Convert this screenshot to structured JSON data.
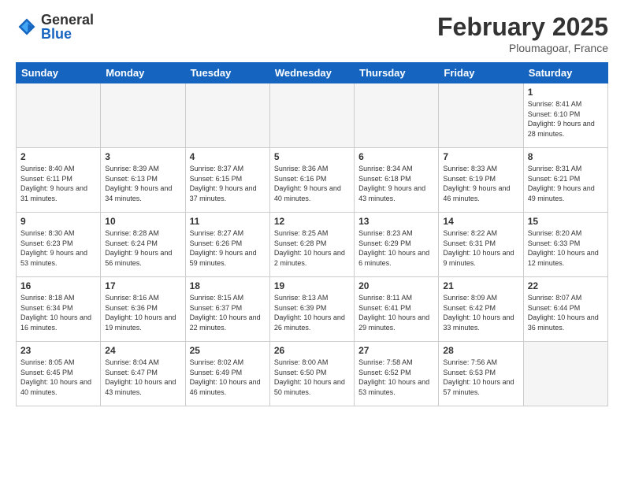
{
  "header": {
    "logo_general": "General",
    "logo_blue": "Blue",
    "month_title": "February 2025",
    "subtitle": "Ploumagoar, France"
  },
  "days_of_week": [
    "Sunday",
    "Monday",
    "Tuesday",
    "Wednesday",
    "Thursday",
    "Friday",
    "Saturday"
  ],
  "weeks": [
    [
      {
        "day": "",
        "empty": true
      },
      {
        "day": "",
        "empty": true
      },
      {
        "day": "",
        "empty": true
      },
      {
        "day": "",
        "empty": true
      },
      {
        "day": "",
        "empty": true
      },
      {
        "day": "",
        "empty": true
      },
      {
        "day": "1",
        "info": "Sunrise: 8:41 AM\nSunset: 6:10 PM\nDaylight: 9 hours and 28 minutes."
      }
    ],
    [
      {
        "day": "2",
        "info": "Sunrise: 8:40 AM\nSunset: 6:11 PM\nDaylight: 9 hours and 31 minutes."
      },
      {
        "day": "3",
        "info": "Sunrise: 8:39 AM\nSunset: 6:13 PM\nDaylight: 9 hours and 34 minutes."
      },
      {
        "day": "4",
        "info": "Sunrise: 8:37 AM\nSunset: 6:15 PM\nDaylight: 9 hours and 37 minutes."
      },
      {
        "day": "5",
        "info": "Sunrise: 8:36 AM\nSunset: 6:16 PM\nDaylight: 9 hours and 40 minutes."
      },
      {
        "day": "6",
        "info": "Sunrise: 8:34 AM\nSunset: 6:18 PM\nDaylight: 9 hours and 43 minutes."
      },
      {
        "day": "7",
        "info": "Sunrise: 8:33 AM\nSunset: 6:19 PM\nDaylight: 9 hours and 46 minutes."
      },
      {
        "day": "8",
        "info": "Sunrise: 8:31 AM\nSunset: 6:21 PM\nDaylight: 9 hours and 49 minutes."
      }
    ],
    [
      {
        "day": "9",
        "info": "Sunrise: 8:30 AM\nSunset: 6:23 PM\nDaylight: 9 hours and 53 minutes."
      },
      {
        "day": "10",
        "info": "Sunrise: 8:28 AM\nSunset: 6:24 PM\nDaylight: 9 hours and 56 minutes."
      },
      {
        "day": "11",
        "info": "Sunrise: 8:27 AM\nSunset: 6:26 PM\nDaylight: 9 hours and 59 minutes."
      },
      {
        "day": "12",
        "info": "Sunrise: 8:25 AM\nSunset: 6:28 PM\nDaylight: 10 hours and 2 minutes."
      },
      {
        "day": "13",
        "info": "Sunrise: 8:23 AM\nSunset: 6:29 PM\nDaylight: 10 hours and 6 minutes."
      },
      {
        "day": "14",
        "info": "Sunrise: 8:22 AM\nSunset: 6:31 PM\nDaylight: 10 hours and 9 minutes."
      },
      {
        "day": "15",
        "info": "Sunrise: 8:20 AM\nSunset: 6:33 PM\nDaylight: 10 hours and 12 minutes."
      }
    ],
    [
      {
        "day": "16",
        "info": "Sunrise: 8:18 AM\nSunset: 6:34 PM\nDaylight: 10 hours and 16 minutes."
      },
      {
        "day": "17",
        "info": "Sunrise: 8:16 AM\nSunset: 6:36 PM\nDaylight: 10 hours and 19 minutes."
      },
      {
        "day": "18",
        "info": "Sunrise: 8:15 AM\nSunset: 6:37 PM\nDaylight: 10 hours and 22 minutes."
      },
      {
        "day": "19",
        "info": "Sunrise: 8:13 AM\nSunset: 6:39 PM\nDaylight: 10 hours and 26 minutes."
      },
      {
        "day": "20",
        "info": "Sunrise: 8:11 AM\nSunset: 6:41 PM\nDaylight: 10 hours and 29 minutes."
      },
      {
        "day": "21",
        "info": "Sunrise: 8:09 AM\nSunset: 6:42 PM\nDaylight: 10 hours and 33 minutes."
      },
      {
        "day": "22",
        "info": "Sunrise: 8:07 AM\nSunset: 6:44 PM\nDaylight: 10 hours and 36 minutes."
      }
    ],
    [
      {
        "day": "23",
        "info": "Sunrise: 8:05 AM\nSunset: 6:45 PM\nDaylight: 10 hours and 40 minutes."
      },
      {
        "day": "24",
        "info": "Sunrise: 8:04 AM\nSunset: 6:47 PM\nDaylight: 10 hours and 43 minutes."
      },
      {
        "day": "25",
        "info": "Sunrise: 8:02 AM\nSunset: 6:49 PM\nDaylight: 10 hours and 46 minutes."
      },
      {
        "day": "26",
        "info": "Sunrise: 8:00 AM\nSunset: 6:50 PM\nDaylight: 10 hours and 50 minutes."
      },
      {
        "day": "27",
        "info": "Sunrise: 7:58 AM\nSunset: 6:52 PM\nDaylight: 10 hours and 53 minutes."
      },
      {
        "day": "28",
        "info": "Sunrise: 7:56 AM\nSunset: 6:53 PM\nDaylight: 10 hours and 57 minutes."
      },
      {
        "day": "",
        "empty": true
      }
    ]
  ]
}
